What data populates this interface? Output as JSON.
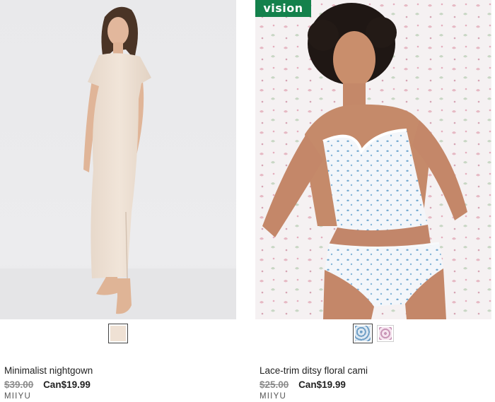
{
  "products": [
    {
      "name": "Minimalist nightgown",
      "old_price": "$39.00",
      "new_price": "Can$19.99",
      "brand": "MIIYU",
      "badge": "",
      "swatches": [
        {
          "color": "#efe1d4",
          "selected": true
        }
      ]
    },
    {
      "name": "Lace-trim ditsy floral cami",
      "old_price": "$25.00",
      "new_price": "Can$19.99",
      "brand": "MIIYU",
      "badge": "vision",
      "swatches": [
        {
          "color": "#a9c8de",
          "selected": true
        },
        {
          "color": "#e7b9d2",
          "selected": false
        }
      ]
    }
  ]
}
